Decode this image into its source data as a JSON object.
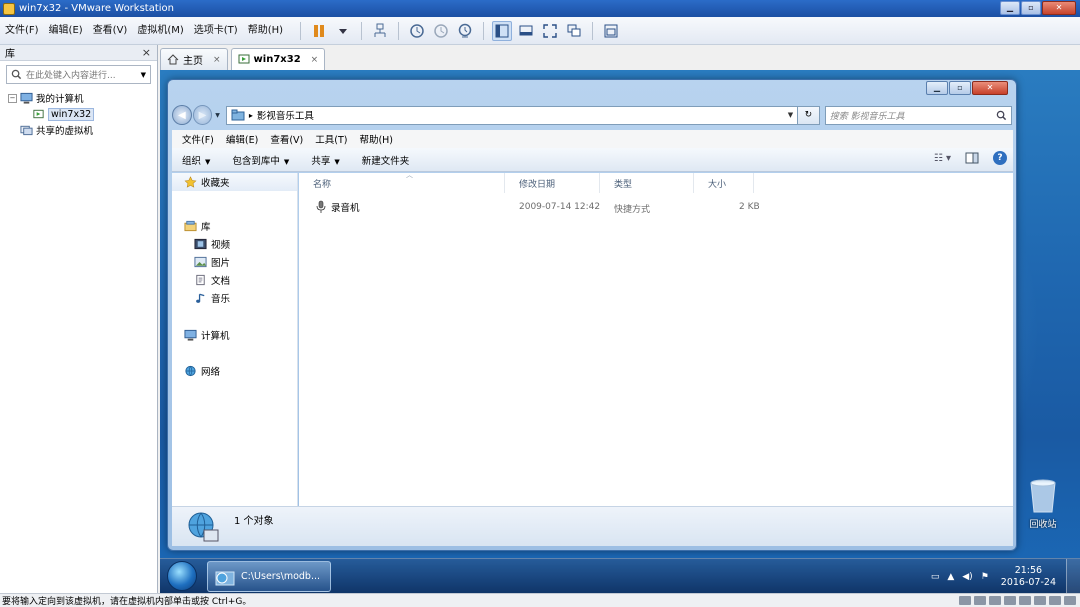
{
  "vmware": {
    "window_title": "win7x32 - VMware Workstation",
    "menu": [
      "文件(F)",
      "编辑(E)",
      "查看(V)",
      "虚拟机(M)",
      "选项卡(T)",
      "帮助(H)"
    ],
    "toolbar_icons": [
      "pause-icon",
      "dropdown-arrow-icon",
      "network-icon",
      "snapshot-take-icon",
      "snapshot-revert-icon",
      "snapshot-manager-icon",
      "sidebar-view-icon",
      "console-view-icon",
      "fullscreen-icon",
      "unity-icon",
      "thumbnail-icon"
    ],
    "library": {
      "title": "库",
      "close": "×",
      "search_placeholder": "在此处键入内容进行...",
      "tree": {
        "root": "我的计算机",
        "toggle": "−",
        "vm": "win7x32",
        "shared": "共享的虚拟机"
      }
    },
    "tabs": [
      {
        "label": "主页",
        "close": "×"
      },
      {
        "label": "win7x32",
        "close": "×"
      }
    ],
    "status_text": "要将输入定向到该虚拟机，请在虚拟机内部单击或按 Ctrl+G。"
  },
  "explorer": {
    "address": {
      "segments": [
        "影视音乐工具"
      ],
      "separator": "▸"
    },
    "search_placeholder": "搜索 影视音乐工具",
    "menu": [
      "文件(F)",
      "编辑(E)",
      "查看(V)",
      "工具(T)",
      "帮助(H)"
    ],
    "commands": [
      "组织",
      "包含到库中",
      "共享",
      "新建文件夹"
    ],
    "nav": {
      "favorites": "收藏夹",
      "libraries": "库",
      "lib_items": [
        "视频",
        "图片",
        "文档",
        "音乐"
      ],
      "computer": "计算机",
      "network": "网络"
    },
    "columns": [
      "名称",
      "修改日期",
      "类型",
      "大小"
    ],
    "files": [
      {
        "name": "录音机",
        "modified": "2009-07-14 12:42",
        "type": "快捷方式",
        "size": "2 KB"
      }
    ],
    "status_count": "1 个对象"
  },
  "desktop": {
    "recycle_bin": "回收站"
  },
  "taskbar": {
    "task_label": "C:\\Users\\modb...",
    "time": "21:56",
    "date": "2016-07-24"
  },
  "colors": {
    "vm_titlebar": "#1c4fa3",
    "guest_desktop": "#1f67b0",
    "explorer_frame": "#9dbfe4",
    "selection": "#dbe6f5"
  }
}
